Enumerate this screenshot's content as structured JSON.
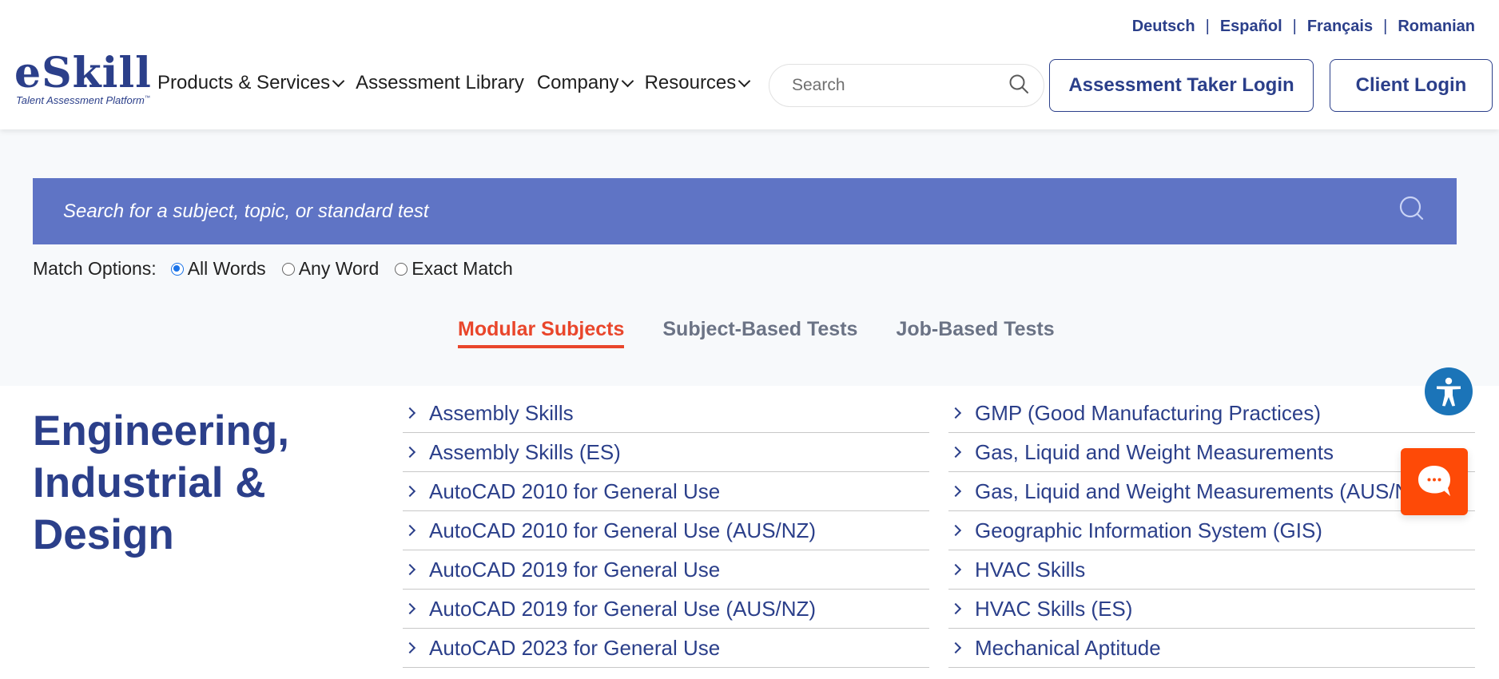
{
  "header": {
    "logo": {
      "name": "eSkill",
      "tagline": "Talent Assessment Platform",
      "trademark": "™"
    },
    "languages": [
      "Deutsch",
      "Español",
      "Français",
      "Romanian"
    ],
    "language_separator": "|",
    "nav": [
      {
        "label": "Products & Services",
        "has_dropdown": true
      },
      {
        "label": "Assessment Library",
        "has_dropdown": false
      },
      {
        "label": "Company",
        "has_dropdown": true
      },
      {
        "label": "Resources",
        "has_dropdown": true
      }
    ],
    "search": {
      "placeholder": "Search",
      "value": "",
      "icon": "search-icon"
    },
    "assessment_taker_login": "Assessment Taker Login",
    "client_login": "Client Login"
  },
  "hero": {
    "search": {
      "placeholder": "Search for a subject, topic, or standard test",
      "value": "",
      "icon": "search-icon"
    },
    "match_options": {
      "label": "Match Options:",
      "options": [
        {
          "label": "All Words",
          "checked": true
        },
        {
          "label": "Any Word",
          "checked": false
        },
        {
          "label": "Exact Match",
          "checked": false
        }
      ]
    },
    "tabs": [
      {
        "label": "Modular Subjects",
        "active": true
      },
      {
        "label": "Subject-Based Tests",
        "active": false
      },
      {
        "label": "Job-Based Tests",
        "active": false
      }
    ]
  },
  "content": {
    "section_title": "Engineering, Industrial & Design",
    "column_1": [
      "Assembly Skills",
      "Assembly Skills (ES)",
      "AutoCAD 2010 for General Use",
      "AutoCAD 2010 for General Use (AUS/NZ)",
      "AutoCAD 2019 for General Use",
      "AutoCAD 2019 for General Use (AUS/NZ)",
      "AutoCAD 2023 for General Use"
    ],
    "column_2": [
      "GMP (Good Manufacturing Practices)",
      "Gas, Liquid and Weight Measurements",
      "Gas, Liquid and Weight Measurements (AUS/NZ)",
      "Geographic Information System (GIS)",
      "HVAC Skills",
      "HVAC Skills (ES)",
      "Mechanical Aptitude"
    ]
  },
  "widgets": {
    "accessibility_icon": "accessibility-icon",
    "chat_icon": "chat-bubble-icon"
  },
  "colors": {
    "brand_navy": "#2b3f8a",
    "search_bar": "#5f74c5",
    "active_tab": "#e9462b",
    "chat_orange": "#fe4a07",
    "accessibility_blue": "#1b74b8"
  }
}
